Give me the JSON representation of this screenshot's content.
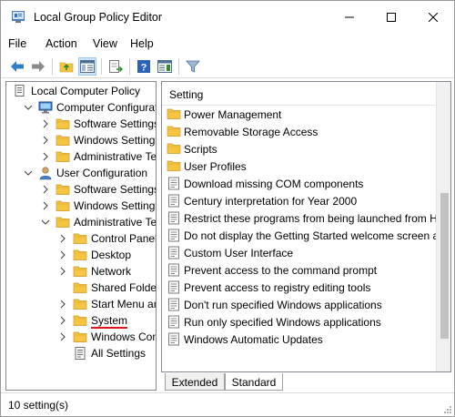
{
  "window": {
    "title": "Local Group Policy Editor",
    "icon": "gpedit-icon"
  },
  "menu": {
    "file": "File",
    "action": "Action",
    "view": "View",
    "help": "Help"
  },
  "tree": {
    "items": [
      {
        "label": "Local Computer Policy",
        "icon": "computer-policy-icon",
        "expander": "none"
      },
      {
        "label": "Computer Configuration",
        "icon": "computer-icon",
        "expander": "expanded"
      },
      {
        "label": "Software Settings",
        "icon": "folder-icon",
        "expander": "collapsed"
      },
      {
        "label": "Windows Settings",
        "icon": "folder-icon",
        "expander": "collapsed"
      },
      {
        "label": "Administrative Tem",
        "icon": "folder-icon",
        "expander": "collapsed"
      },
      {
        "label": "User Configuration",
        "icon": "user-icon",
        "expander": "expanded"
      },
      {
        "label": "Software Settings",
        "icon": "folder-icon",
        "expander": "collapsed"
      },
      {
        "label": "Windows Settings",
        "icon": "folder-icon",
        "expander": "collapsed"
      },
      {
        "label": "Administrative Tem",
        "icon": "folder-icon",
        "expander": "expanded"
      },
      {
        "label": "Control Panel",
        "icon": "folder-icon",
        "expander": "collapsed"
      },
      {
        "label": "Desktop",
        "icon": "folder-icon",
        "expander": "collapsed"
      },
      {
        "label": "Network",
        "icon": "folder-icon",
        "expander": "collapsed"
      },
      {
        "label": "Shared Folders",
        "icon": "folder-icon",
        "expander": "none"
      },
      {
        "label": "Start Menu and",
        "icon": "folder-icon",
        "expander": "collapsed"
      },
      {
        "label": "System",
        "icon": "folder-icon",
        "expander": "collapsed",
        "selected": true
      },
      {
        "label": "Windows Comp",
        "icon": "folder-icon",
        "expander": "collapsed"
      },
      {
        "label": "All Settings",
        "icon": "all-settings-icon",
        "expander": "none"
      }
    ]
  },
  "list": {
    "header": "Setting",
    "items": [
      {
        "label": "Power Management",
        "icon": "folder-icon"
      },
      {
        "label": "Removable Storage Access",
        "icon": "folder-icon"
      },
      {
        "label": "Scripts",
        "icon": "folder-icon"
      },
      {
        "label": "User Profiles",
        "icon": "folder-icon"
      },
      {
        "label": "Download missing COM components",
        "icon": "policy-setting-icon"
      },
      {
        "label": "Century interpretation for Year 2000",
        "icon": "policy-setting-icon"
      },
      {
        "label": "Restrict these programs from being launched from H",
        "icon": "policy-setting-icon"
      },
      {
        "label": "Do not display the Getting Started welcome screen a",
        "icon": "policy-setting-icon"
      },
      {
        "label": "Custom User Interface",
        "icon": "policy-setting-icon"
      },
      {
        "label": "Prevent access to the command prompt",
        "icon": "policy-setting-icon"
      },
      {
        "label": "Prevent access to registry editing tools",
        "icon": "policy-setting-icon"
      },
      {
        "label": "Don't run specified Windows applications",
        "icon": "policy-setting-icon"
      },
      {
        "label": "Run only specified Windows applications",
        "icon": "policy-setting-icon"
      },
      {
        "label": "Windows Automatic Updates",
        "icon": "policy-setting-icon"
      }
    ]
  },
  "tabs": {
    "extended": "Extended",
    "standard": "Standard",
    "active": "standard"
  },
  "status": {
    "text": "10 setting(s)"
  },
  "colors": {
    "selection_underline": "#e0141c",
    "folder": "#f5c542",
    "accent": "#1e73be"
  }
}
